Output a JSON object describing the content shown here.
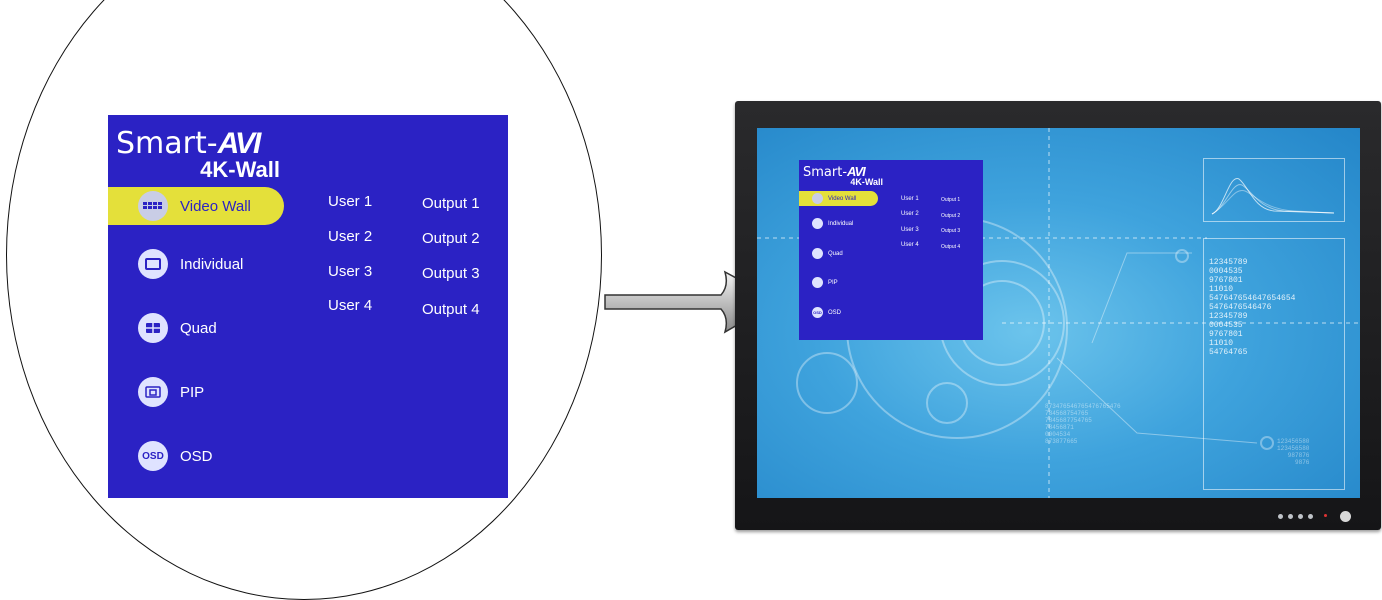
{
  "brand": {
    "word": "Smart-",
    "mark": "AVI",
    "model": "4K-Wall"
  },
  "menu": [
    {
      "label": "Video Wall",
      "icon": "video-wall-icon",
      "active": true
    },
    {
      "label": "Individual",
      "icon": "individual-icon",
      "active": false
    },
    {
      "label": "Quad",
      "icon": "quad-icon",
      "active": false
    },
    {
      "label": "PIP",
      "icon": "pip-icon",
      "active": false
    },
    {
      "label": "OSD",
      "icon": "osd-icon",
      "active": false
    }
  ],
  "osd_icon_text": "OSD",
  "users": [
    "User 1",
    "User 2",
    "User 3",
    "User 4"
  ],
  "outputs": [
    "Output 1",
    "Output 2",
    "Output 3",
    "Output 4"
  ],
  "colors": {
    "osd_background": "#2b22c4",
    "active_item": "#e4e03a",
    "screen": "#3fa3dd",
    "bezel": "#1c1c1e"
  },
  "screen_numbers": {
    "panel_list": [
      "12345789",
      "0004535",
      "9767801",
      "11010",
      "54764765464765465​4",
      "5476476546476",
      "12345789",
      "0004535",
      "9767801",
      "11010",
      "54764765"
    ],
    "center_list": [
      "873476546765476765476",
      "784568754765",
      "7845687754765",
      "78456871",
      "0004534",
      "873877665"
    ],
    "right_list": [
      "123456580",
      "123456580",
      "987876",
      "9876"
    ]
  }
}
